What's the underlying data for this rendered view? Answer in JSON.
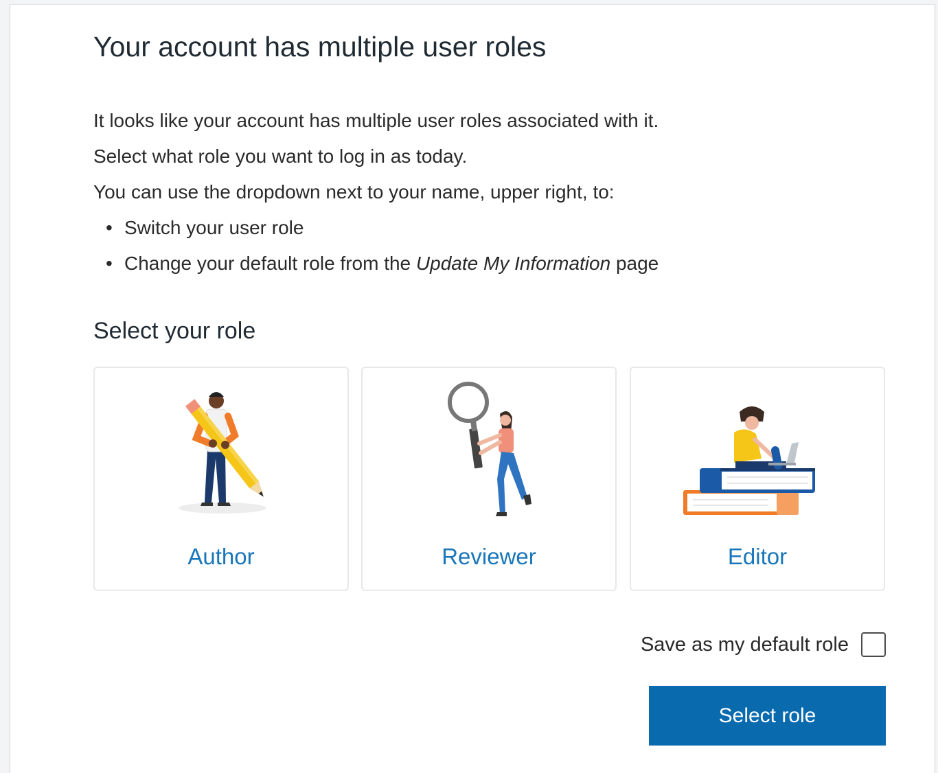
{
  "dialog": {
    "title": "Your account has multiple user roles",
    "intro_lines": [
      "It looks like your account has multiple user roles associated with it.",
      "Select what role you want to log in as today.",
      "You can use the dropdown next to your name, upper right, to:"
    ],
    "bullets": [
      {
        "before": "Switch your user role",
        "italic": "",
        "after": ""
      },
      {
        "before": "Change your default role from the ",
        "italic": "Update My Information",
        "after": " page"
      }
    ],
    "bullet_char": "•",
    "section_heading": "Select your role",
    "roles": [
      {
        "label": "Author",
        "icon": "author-pencil-illustration"
      },
      {
        "label": "Reviewer",
        "icon": "reviewer-magnifier-illustration"
      },
      {
        "label": "Editor",
        "icon": "editor-books-laptop-illustration"
      }
    ],
    "default_role_label": "Save as my default role",
    "default_role_checked": false,
    "select_button_label": "Select role",
    "colors": {
      "link_blue": "#1976ba",
      "button_blue": "#0a6aae",
      "accent_orange": "#f07c2a",
      "accent_yellow": "#f5c518",
      "navy": "#1b3a6b"
    }
  }
}
